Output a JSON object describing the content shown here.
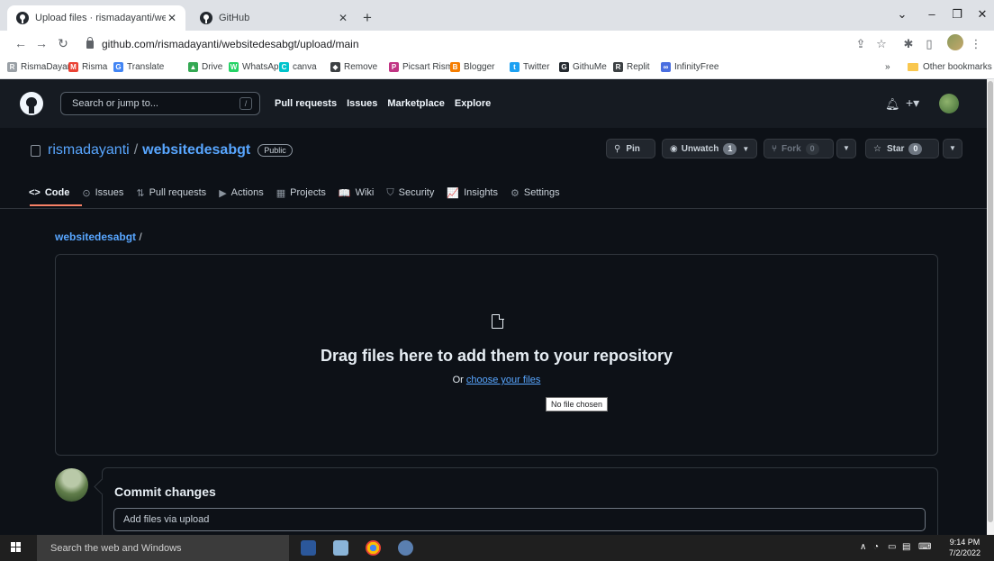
{
  "browser": {
    "tabs": [
      {
        "title": "Upload files · rismadayanti/websi",
        "close": "✕",
        "active": true
      },
      {
        "title": "GitHub",
        "close": "✕",
        "active": false
      }
    ],
    "new_tab": "+",
    "url": "github.com/rismadayanti/websitedesabgt/upload/main",
    "bookmarks": [
      {
        "label": "RismaDayanti",
        "icon_color": "#9aa0a6",
        "glyph": "R"
      },
      {
        "label": "Risma",
        "icon_color": "#ea4335",
        "glyph": "M"
      },
      {
        "label": "Translate",
        "icon_color": "#4285f4",
        "glyph": "G"
      },
      {
        "label": "Drive",
        "icon_color": "#34a853",
        "glyph": "▲"
      },
      {
        "label": "WhatsApp",
        "icon_color": "#25d366",
        "glyph": "W"
      },
      {
        "label": "canva",
        "icon_color": "#00c4cc",
        "glyph": "C"
      },
      {
        "label": "Remove",
        "icon_color": "#3c4043",
        "glyph": "◆"
      },
      {
        "label": "Picsart Risma",
        "icon_color": "#c13584",
        "glyph": "P"
      },
      {
        "label": "Blogger",
        "icon_color": "#f57d00",
        "glyph": "B"
      },
      {
        "label": "Twitter",
        "icon_color": "#1da1f2",
        "glyph": "t"
      },
      {
        "label": "GithuMe",
        "icon_color": "#24292f",
        "glyph": "G"
      },
      {
        "label": "Replit",
        "icon_color": "#3c4043",
        "glyph": "R"
      },
      {
        "label": "InfinityFree",
        "icon_color": "#4a6ee0",
        "glyph": "∞"
      }
    ],
    "overflow": "»",
    "other_bookmarks": "Other bookmarks"
  },
  "gh_header": {
    "search_placeholder": "Search or jump to...",
    "search_key": "/",
    "nav": [
      "Pull requests",
      "Issues",
      "Marketplace",
      "Explore"
    ],
    "plus": "+▾"
  },
  "repo": {
    "owner": "rismadayanti",
    "separator": "/",
    "name": "websitedesabgt",
    "visibility": "Public",
    "pin_label": "Pin",
    "unwatch_label": "Unwatch",
    "unwatch_count": "1",
    "fork_label": "Fork",
    "fork_count": "0",
    "star_label": "Star",
    "star_count": "0",
    "tabs": [
      {
        "label": "Code",
        "icon": "<>"
      },
      {
        "label": "Issues",
        "icon": "⊙"
      },
      {
        "label": "Pull requests",
        "icon": "⇅"
      },
      {
        "label": "Actions",
        "icon": "▶"
      },
      {
        "label": "Projects",
        "icon": "▦"
      },
      {
        "label": "Wiki",
        "icon": "📖"
      },
      {
        "label": "Security",
        "icon": "⛉"
      },
      {
        "label": "Insights",
        "icon": "📈"
      },
      {
        "label": "Settings",
        "icon": "⚙"
      }
    ]
  },
  "upload": {
    "breadcrumb_repo": "websitedesabgt",
    "breadcrumb_sep": "/",
    "drop_title": "Drag files here to add them to your repository",
    "drop_prefix": "Or",
    "choose_link": "choose your files",
    "tooltip": "No file chosen"
  },
  "commit": {
    "title": "Commit changes",
    "placeholder": "Add files via upload"
  },
  "taskbar": {
    "search": "Search the web and Windows",
    "time": "9:14 PM",
    "date": "7/2/2022"
  }
}
